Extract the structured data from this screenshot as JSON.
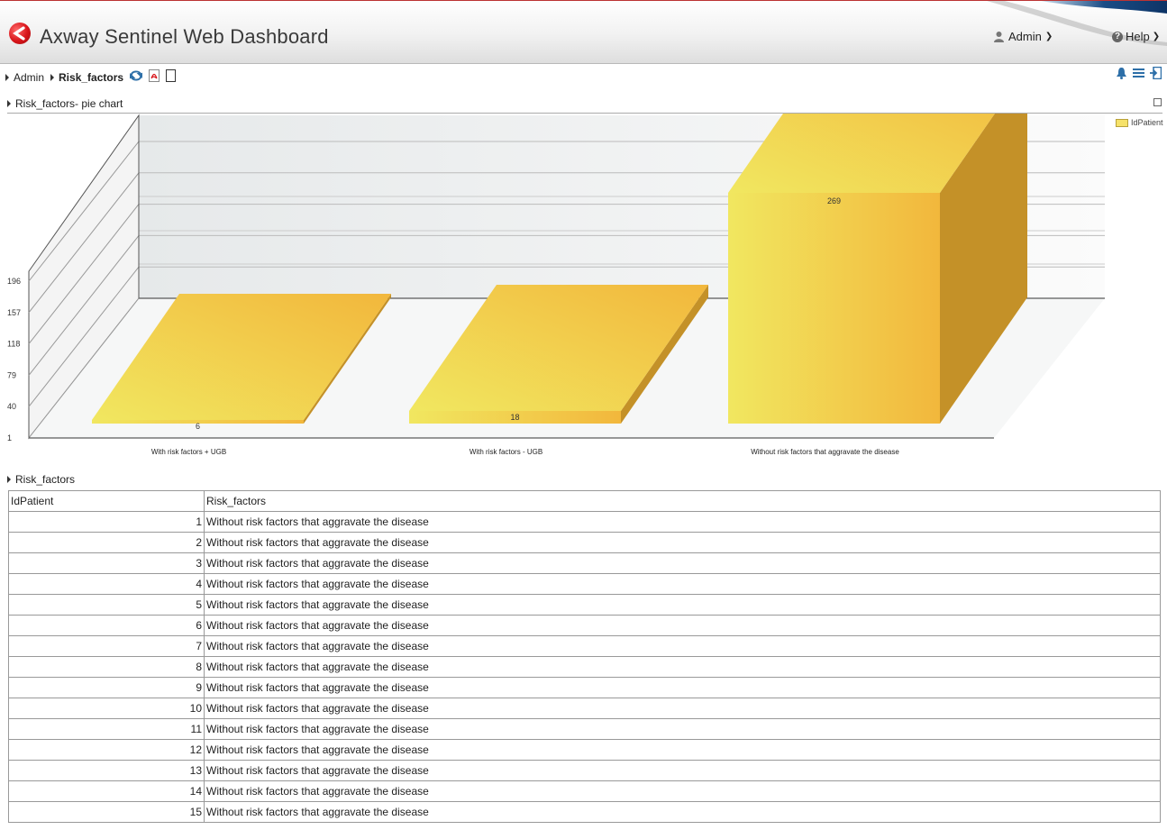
{
  "app": {
    "title": "Axway Sentinel Web Dashboard"
  },
  "header": {
    "user_label": "Admin",
    "help_label": "Help"
  },
  "breadcrumb": {
    "root": "Admin",
    "current": "Risk_factors"
  },
  "chart_panel": {
    "title": "Risk_factors- pie chart"
  },
  "table_panel": {
    "title": "Risk_factors"
  },
  "colors": {
    "bar_light": "#f1e760",
    "bar_dark": "#f2b73c",
    "bar_side": "#c49128",
    "brand_red": "#d8151a"
  },
  "icons": [
    "user-icon",
    "chevron-down-icon",
    "help-icon",
    "refresh-icon",
    "pdf-icon",
    "page-icon",
    "bell-icon",
    "menu-icon",
    "exit-icon",
    "minimize-icon"
  ],
  "chart_data": {
    "type": "bar",
    "categories": [
      "With risk factors + UGB",
      "With risk factors - UGB",
      "Without risk factors that aggravate the disease"
    ],
    "series": [
      {
        "name": "IdPatient",
        "values": [
          6,
          18,
          269
        ]
      }
    ],
    "yticks": [
      "1",
      "40",
      "79",
      "118",
      "157",
      "196"
    ],
    "ylim": [
      1,
      196
    ],
    "grid": true,
    "legend": "top-right",
    "three_d": true
  },
  "table": {
    "columns": [
      "IdPatient",
      "Risk_factors"
    ],
    "rows": [
      [
        "1",
        "Without risk factors that aggravate the disease"
      ],
      [
        "2",
        "Without risk factors that aggravate the disease"
      ],
      [
        "3",
        "Without risk factors that aggravate the disease"
      ],
      [
        "4",
        "Without risk factors that aggravate the disease"
      ],
      [
        "5",
        "Without risk factors that aggravate the disease"
      ],
      [
        "6",
        "Without risk factors that aggravate the disease"
      ],
      [
        "7",
        "Without risk factors that aggravate the disease"
      ],
      [
        "8",
        "Without risk factors that aggravate the disease"
      ],
      [
        "9",
        "Without risk factors that aggravate the disease"
      ],
      [
        "10",
        "Without risk factors that aggravate the disease"
      ],
      [
        "11",
        "Without risk factors that aggravate the disease"
      ],
      [
        "12",
        "Without risk factors that aggravate the disease"
      ],
      [
        "13",
        "Without risk factors that aggravate the disease"
      ],
      [
        "14",
        "Without risk factors that aggravate the disease"
      ],
      [
        "15",
        "Without risk factors that aggravate the disease"
      ]
    ]
  }
}
